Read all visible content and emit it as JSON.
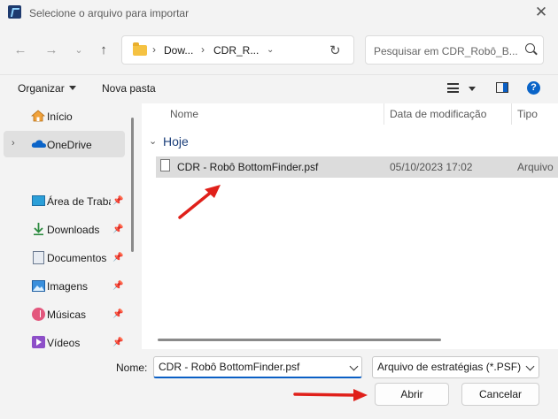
{
  "window": {
    "title": "Selecione o arquivo para importar",
    "close_icon": "close-icon"
  },
  "nav": {
    "breadcrumb": [
      "Dow...",
      "CDR_R..."
    ],
    "search_placeholder": "Pesquisar em CDR_Robô_B..."
  },
  "toolbar": {
    "organize_label": "Organizar",
    "new_folder_label": "Nova pasta"
  },
  "sidebar": {
    "items": [
      {
        "label": "Início",
        "icon": "home-icon"
      },
      {
        "label": "OneDrive",
        "icon": "cloud-icon"
      },
      {
        "label": "Área de Traba",
        "icon": "desktop-icon"
      },
      {
        "label": "Downloads",
        "icon": "download-icon"
      },
      {
        "label": "Documentos",
        "icon": "document-icon"
      },
      {
        "label": "Imagens",
        "icon": "image-icon"
      },
      {
        "label": "Músicas",
        "icon": "music-icon"
      },
      {
        "label": "Vídeos",
        "icon": "video-icon"
      }
    ]
  },
  "columns": {
    "name": "Nome",
    "date": "Data de modificação",
    "type": "Tipo"
  },
  "group": {
    "label": "Hoje"
  },
  "files": [
    {
      "name": "CDR - Robô BottomFinder.psf",
      "date": "05/10/2023 17:02",
      "type": "Arquivo"
    }
  ],
  "bottom": {
    "name_label": "Nome:",
    "name_value": "CDR - Robô BottomFinder.psf",
    "filetype_value": "Arquivo de estratégias (*.PSF)",
    "open_label": "Abrir",
    "cancel_label": "Cancelar"
  },
  "colors": {
    "accent": "#0a5fc5",
    "annotation_arrow": "#e0201a"
  }
}
